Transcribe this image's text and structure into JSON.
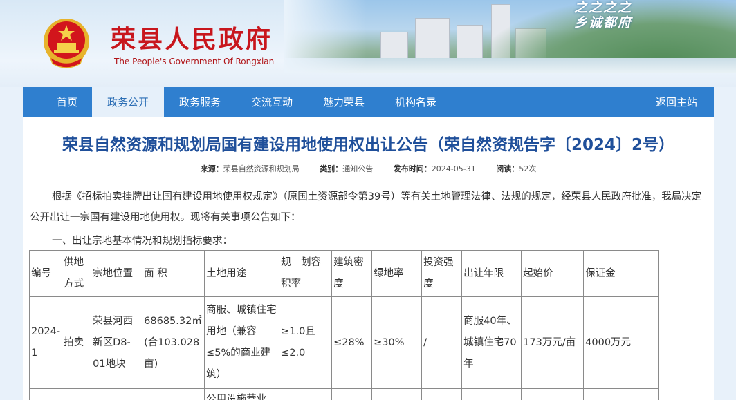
{
  "header": {
    "site_title": "荣县人民政府",
    "site_subtitle": "The People's Government Of Rongxian",
    "slogan_line1": "之之之之",
    "slogan_line2": "乡诚都府"
  },
  "nav": {
    "items": [
      "首页",
      "政务公开",
      "政务服务",
      "交流互动",
      "魅力荣县",
      "机构名录"
    ],
    "active": "政务公开",
    "back_link": "返回主站"
  },
  "article": {
    "title": "荣县自然资源和规划局国有建设用地使用权出让公告（荣自然资规告字〔2024〕2号）",
    "source_label": "来源：",
    "source_value": "荣县自然资源和规划局",
    "category_label": "类别：",
    "category_value": "通知公告",
    "date_label": "发布时间：",
    "date_value": "2024-05-31",
    "reads_label": "阅读：",
    "reads_value": "52次",
    "paragraph1": "根据《招标拍卖挂牌出让国有建设用地使用权规定》（原国土资源部令第39号）等有关土地管理法律、法规的规定，经荣县人民政府批准，我局决定公开出让一宗国有建设用地使用权。现将有关事项公告如下：",
    "paragraph2": "一、出让宗地基本情况和规划指标要求："
  },
  "table": {
    "headers": [
      "编号",
      "供地方式",
      "宗地位置",
      "面 积",
      "土地用途",
      "规　划容积率",
      "建筑密度",
      "绿地率",
      "投资强度",
      "出让年限",
      "起始价",
      "保证金"
    ],
    "row1": [
      "2024-1",
      "拍卖",
      "荣县河西新区D8-01地块",
      "68685.32㎡(合103.028亩)",
      "商服、城镇住宅用地（兼容≤5%的商业建筑）",
      "≥1.0且≤2.0",
      "≤28%",
      "≥30%",
      "/",
      "商服40年、城镇住宅70年",
      "173万元/亩",
      "4000万元"
    ],
    "row2_partial": "公用设施营业"
  }
}
